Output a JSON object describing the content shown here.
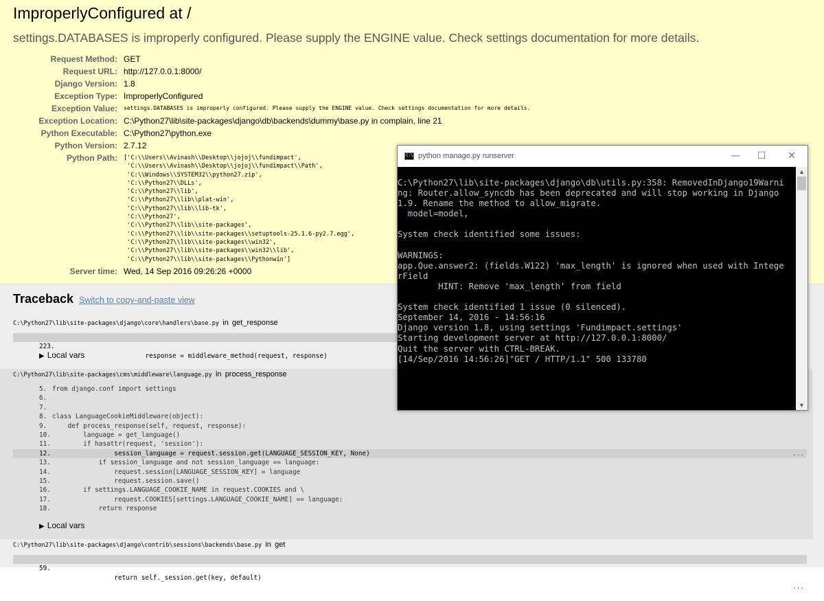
{
  "error": {
    "title": "ImproperlyConfigured at /",
    "subtitle": "settings.DATABASES is improperly configured. Please supply the ENGINE value. Check settings documentation for more details."
  },
  "meta": [
    {
      "key": "Request Method:",
      "value": "GET"
    },
    {
      "key": "Request URL:",
      "value": "http://127.0.0.1:8000/"
    },
    {
      "key": "Django Version:",
      "value": "1.8"
    },
    {
      "key": "Exception Type:",
      "value": "ImproperlyConfigured"
    },
    {
      "key": "Exception Value:",
      "value": "settings.DATABASES is improperly configured. Please supply the ENGINE value. Check settings documentation for more details."
    },
    {
      "key": "Exception Location:",
      "value": "C:\\Python27\\lib\\site-packages\\django\\db\\backends\\dummy\\base.py in complain, line 21"
    },
    {
      "key": "Python Executable:",
      "value": "C:\\Python27\\python.exe"
    },
    {
      "key": "Python Version:",
      "value": "2.7.12"
    },
    {
      "key": "Python Path:",
      "value": "['C:\\\\Users\\\\Avinash\\\\Desktop\\\\jojoj\\\\fundimpact',\n 'C:\\\\Users\\\\Avinash\\\\Desktop\\\\jojoj\\\\fundimpact\\\\Path',\n 'C:\\\\Windows\\\\SYSTEM32\\\\python27.zip',\n 'C:\\\\Python27\\\\DLLs',\n 'C:\\\\Python27\\\\lib',\n 'C:\\\\Python27\\\\lib\\\\plat-win',\n 'C:\\\\Python27\\\\lib\\\\lib-tk',\n 'C:\\\\Python27',\n 'C:\\\\Python27\\\\lib\\\\site-packages',\n 'C:\\\\Python27\\\\lib\\\\site-packages\\\\setuptools-25.1.6-py2.7.egg',\n 'C:\\\\Python27\\\\lib\\\\site-packages\\\\win32',\n 'C:\\\\Python27\\\\lib\\\\site-packages\\\\win32\\\\lib',\n 'C:\\\\Python27\\\\lib\\\\site-packages\\\\Pythonwin']"
    },
    {
      "key": "Server time:",
      "value": "Wed, 14 Sep 2016 09:26:26 +0000"
    }
  ],
  "traceback": {
    "title": "Traceback",
    "switch_link": "Switch to copy-and-paste view",
    "in_word": "in",
    "local_vars": "Local vars",
    "dots": "...",
    "frames": [
      {
        "path": "C:\\Python27\\lib\\site-packages\\django\\core\\handlers\\base.py",
        "function": "get_response",
        "lines": [
          {
            "no": "223.",
            "code": "                        response = middleware_method(request, response)",
            "context": true
          }
        ]
      },
      {
        "path": "C:\\Python27\\lib\\site-packages\\cms\\middleware\\language.py",
        "function": "process_response",
        "lines": [
          {
            "no": "5.",
            "code": "from django.conf import settings",
            "context": false
          },
          {
            "no": "6.",
            "code": "",
            "context": false
          },
          {
            "no": "7.",
            "code": "",
            "context": false
          },
          {
            "no": "8.",
            "code": "class LanguageCookieMiddleware(object):",
            "context": false
          },
          {
            "no": "9.",
            "code": "    def process_response(self, request, response):",
            "context": false
          },
          {
            "no": "10.",
            "code": "        language = get_language()",
            "context": false
          },
          {
            "no": "11.",
            "code": "        if hasattr(request, 'session'):",
            "context": false
          },
          {
            "no": "12.",
            "code": "                session_language = request.session.get(LANGUAGE_SESSION_KEY, None)",
            "context": true
          },
          {
            "no": "13.",
            "code": "            if session_language and not session_language == language:",
            "context": false
          },
          {
            "no": "14.",
            "code": "                request.session[LANGUAGE_SESSION_KEY] = language",
            "context": false
          },
          {
            "no": "15.",
            "code": "                request.session.save()",
            "context": false
          },
          {
            "no": "16.",
            "code": "        if settings.LANGUAGE_COOKIE_NAME in request.COOKIES and \\",
            "context": false
          },
          {
            "no": "17.",
            "code": "                request.COOKIES[settings.LANGUAGE_COOKIE_NAME] == language:",
            "context": false
          },
          {
            "no": "18.",
            "code": "            return response",
            "context": false
          }
        ]
      },
      {
        "path": "C:\\Python27\\lib\\site-packages\\django\\contrib\\sessions\\backends\\base.py",
        "function": "get",
        "lines": [
          {
            "no": "59.",
            "code": "                return self._session.get(key, default)",
            "context": true
          }
        ]
      }
    ]
  },
  "console": {
    "title": "python  manage.py runserver",
    "minimize": "—",
    "maximize": "☐",
    "close": "✕",
    "text": "C:\\Python27\\lib\\site-packages\\django\\db\\utils.py:358: RemovedInDjango19Warni\nng: Router.allow_syncdb has been deprecated and will stop working in Django\n1.9. Rename the method to allow_migrate.\n  model=model,\n\nSystem check identified some issues:\n\nWARNINGS:\napp.Que.answer2: (fields.W122) 'max_length' is ignored when used with Intege\nrField\n        HINT: Remove 'max_length' from field\n\nSystem check identified 1 issue (0 silenced).\nSeptember 14, 2016 - 14:56:16\nDjango version 1.8, using settings 'Fundimpact.settings'\nStarting development server at http://127.0.0.1:8000/\nQuit the server with CTRL-BREAK.\n[14/Sep/2016 14:56:26]\"GET / HTTP/1.1\" 500 133780"
  },
  "colors": {
    "summary_bg": "#ffffcc",
    "traceback_bg": "#eeeeee",
    "link": "#5b80b2",
    "console_bg": "#000000",
    "console_fg": "#c0c0c0"
  },
  "icons": {
    "console_icon": "console-window-icon",
    "expand": "triangle-right-icon"
  }
}
